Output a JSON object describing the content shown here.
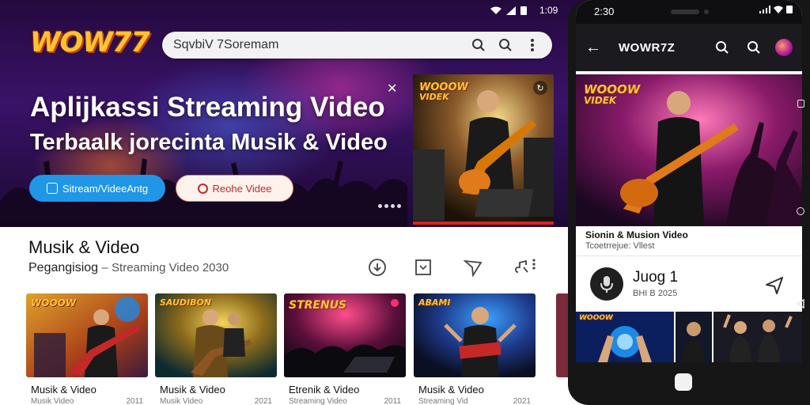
{
  "status_bar": {
    "time": "1:09"
  },
  "logo": {
    "text": "WOW77"
  },
  "search": {
    "value": "SqvbiV 7Soremam"
  },
  "hero": {
    "title": "Aplijkassi Streaming Video",
    "subtitle": "Terbaalk jorecinta Musik & Video",
    "primary_button": "Sitream/VideeAntg",
    "secondary_button": "Reohe Videe",
    "thumb_logo_line1": "WOOOW",
    "thumb_logo_line2": "VIDEK"
  },
  "section": {
    "title": "Musik & Video",
    "subtitle_a": "Pegangisiog",
    "subtitle_b": "– Streaming Video 2030"
  },
  "videos": [
    {
      "title": "Musik & Video",
      "meta_left": "Musik Video",
      "meta_right": "2011",
      "logo": "WOOOW"
    },
    {
      "title": "Musik & Video",
      "meta_left": "Musik Video",
      "meta_right": "2021",
      "logo": "SAUDIBON"
    },
    {
      "title": "Etrenik & Video",
      "meta_left": "Streaming Video",
      "meta_right": "2011",
      "logo": "STRENUS"
    },
    {
      "title": "Musik & Video",
      "meta_left": "Streaming Vid",
      "meta_right": "2021",
      "logo": "ABAMI"
    }
  ],
  "phone": {
    "status_time": "2:30",
    "app_title": "WOWR7Z",
    "video_logo_line1": "WOOOW",
    "video_logo_line2": "VIDEK",
    "video_title": "Sionin & Musion Video",
    "video_subtitle": "Tcoetrrejue: Vllest",
    "channel_name": "Juog 1",
    "channel_sub": "BHI B 2025",
    "thumb_logo": "WOOOW"
  },
  "colors": {
    "accent_blue": "#2096e6",
    "accent_red": "#c62828",
    "logo_gold": "#ffc233",
    "hero_purple": "#3a1268"
  },
  "icons": [
    "wifi-icon",
    "signal-icon",
    "battery-icon",
    "search-icon",
    "more-vert-icon",
    "play-icon",
    "record-icon",
    "close-icon",
    "download-icon",
    "crop-icon",
    "send-icon",
    "music-note-icon",
    "back-arrow-icon",
    "microphone-icon",
    "share-icon"
  ]
}
